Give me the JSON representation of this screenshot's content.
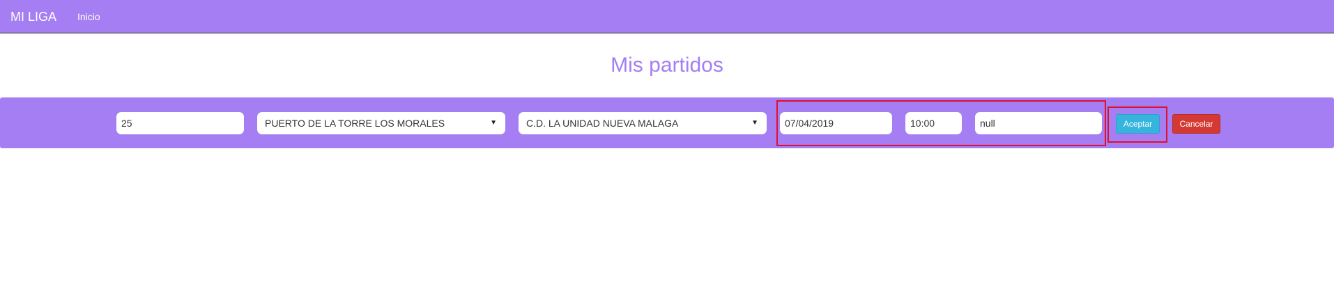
{
  "navbar": {
    "brand": "MI LIGA",
    "links": [
      {
        "label": "Inicio"
      }
    ]
  },
  "page": {
    "title": "Mis partidos"
  },
  "match_form": {
    "round": "25",
    "home_team": "PUERTO DE LA TORRE LOS MORALES",
    "away_team": "C.D. LA UNIDAD NUEVA MALAGA",
    "date": "07/04/2019",
    "time": "10:00",
    "result": "null",
    "accept_label": "Aceptar",
    "cancel_label": "Cancelar"
  },
  "colors": {
    "accent": "#a47ef2",
    "accept": "#36b4dd",
    "cancel": "#d43933",
    "highlight": "#e0102a"
  },
  "icons": {
    "select_arrow": "triangle-down-icon"
  }
}
